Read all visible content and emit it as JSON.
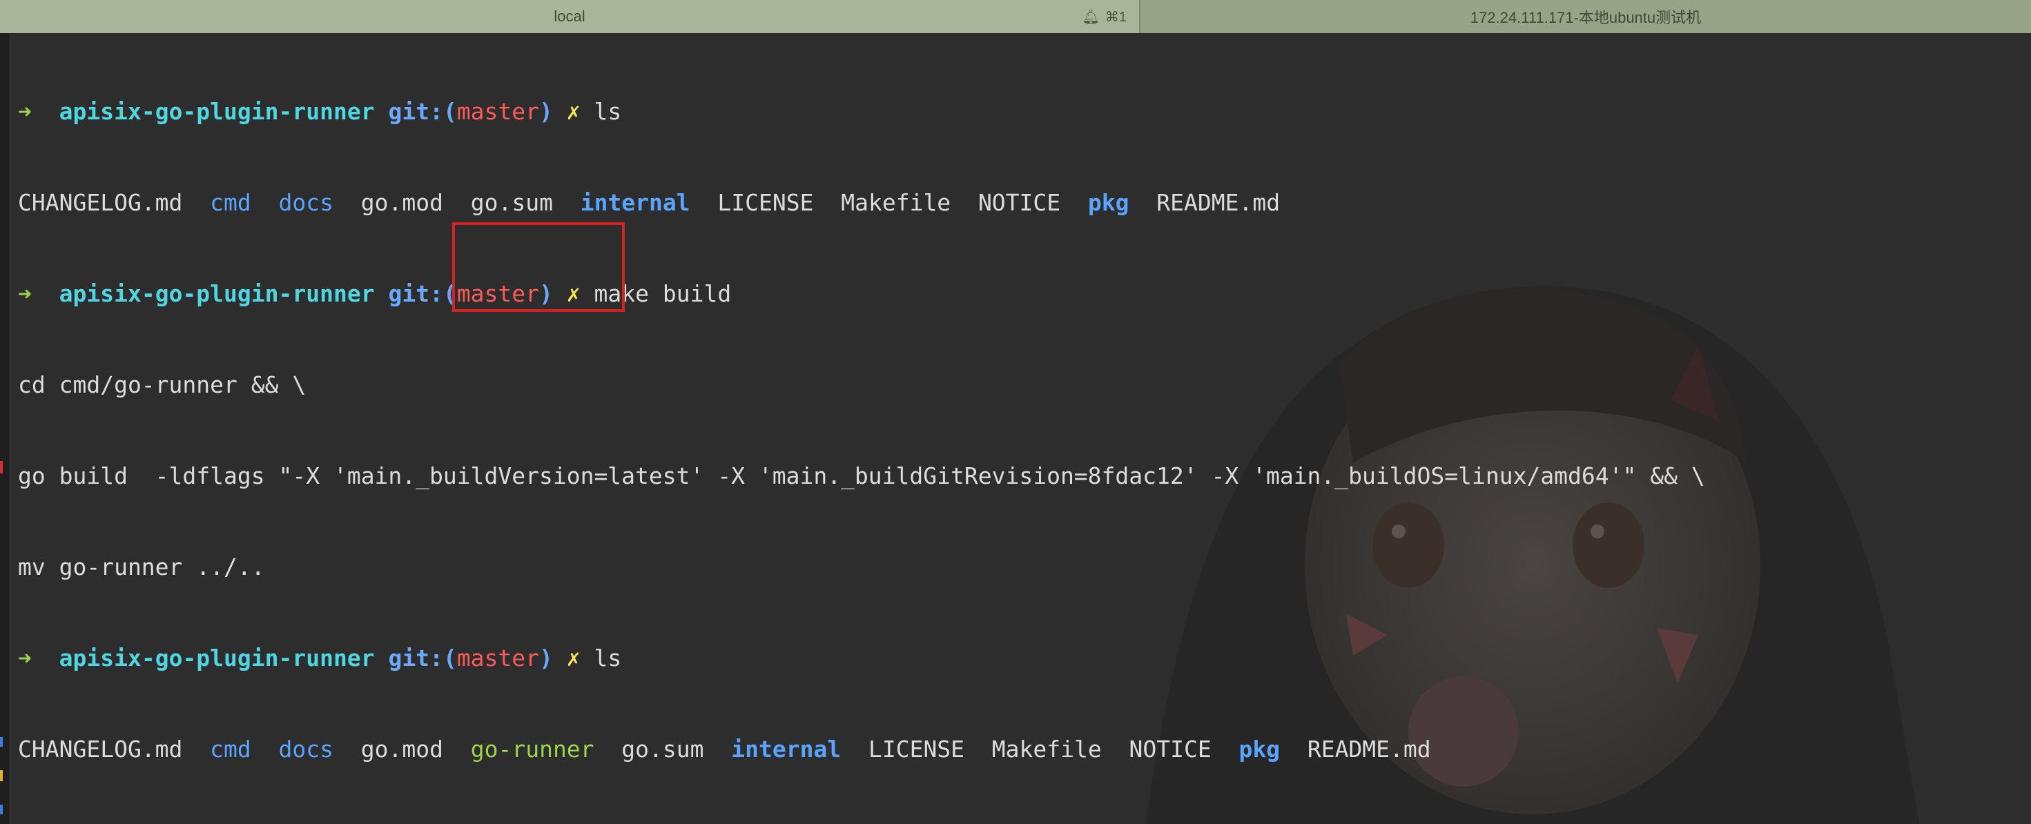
{
  "tabs": {
    "local": {
      "label": "local",
      "shortcut": "⌘1",
      "icon": "bell-icon"
    },
    "remote": {
      "label": "172.24.111.171-本地ubuntu测试机"
    }
  },
  "prompt": {
    "arrow": "➜",
    "dir": "apisix-go-plugin-runner",
    "git_prefix": "git:(",
    "branch": "master",
    "git_suffix": ")",
    "dirty_mark": "✗"
  },
  "terminal": {
    "cmd1": "ls",
    "ls1": [
      {
        "text": "CHANGELOG.md",
        "kind": "file"
      },
      {
        "text": "cmd",
        "kind": "dir"
      },
      {
        "text": "docs",
        "kind": "dir"
      },
      {
        "text": "go.mod",
        "kind": "file"
      },
      {
        "text": "go.sum",
        "kind": "file"
      },
      {
        "text": "internal",
        "kind": "dir"
      },
      {
        "text": "LICENSE",
        "kind": "file"
      },
      {
        "text": "Makefile",
        "kind": "file"
      },
      {
        "text": "NOTICE",
        "kind": "file"
      },
      {
        "text": "pkg",
        "kind": "dir"
      },
      {
        "text": "README.md",
        "kind": "file"
      }
    ],
    "cmd2": "make build",
    "build_lines": [
      "cd cmd/go-runner && \\",
      "go build  -ldflags \"-X 'main._buildVersion=latest' -X 'main._buildGitRevision=8fdac12' -X 'main._buildOS=linux/amd64'\" && \\",
      "mv go-runner ../.."
    ],
    "cmd3": "ls",
    "ls2": [
      {
        "text": "CHANGELOG.md",
        "kind": "file"
      },
      {
        "text": "cmd",
        "kind": "dir"
      },
      {
        "text": "docs",
        "kind": "dir"
      },
      {
        "text": "go.mod",
        "kind": "file"
      },
      {
        "text": "go-runner",
        "kind": "exec"
      },
      {
        "text": "go.sum",
        "kind": "file"
      },
      {
        "text": "internal",
        "kind": "dir"
      },
      {
        "text": "LICENSE",
        "kind": "file"
      },
      {
        "text": "Makefile",
        "kind": "file"
      },
      {
        "text": "NOTICE",
        "kind": "file"
      },
      {
        "text": "pkg",
        "kind": "dir"
      },
      {
        "text": "README.md",
        "kind": "file"
      }
    ]
  },
  "colors": {
    "background": "#2d2d2d",
    "prompt_arrow": "#9bd34a",
    "prompt_dir": "#4fd6e0",
    "git_label": "#6aa9ff",
    "branch": "#ff5a5a",
    "dirty_mark": "#f5e35a",
    "directory": "#5aa4ff",
    "executable": "#9bd34a",
    "annotation_box": "#d82020",
    "tab_active": "#a9b59a",
    "tab_inactive": "#97a487"
  }
}
